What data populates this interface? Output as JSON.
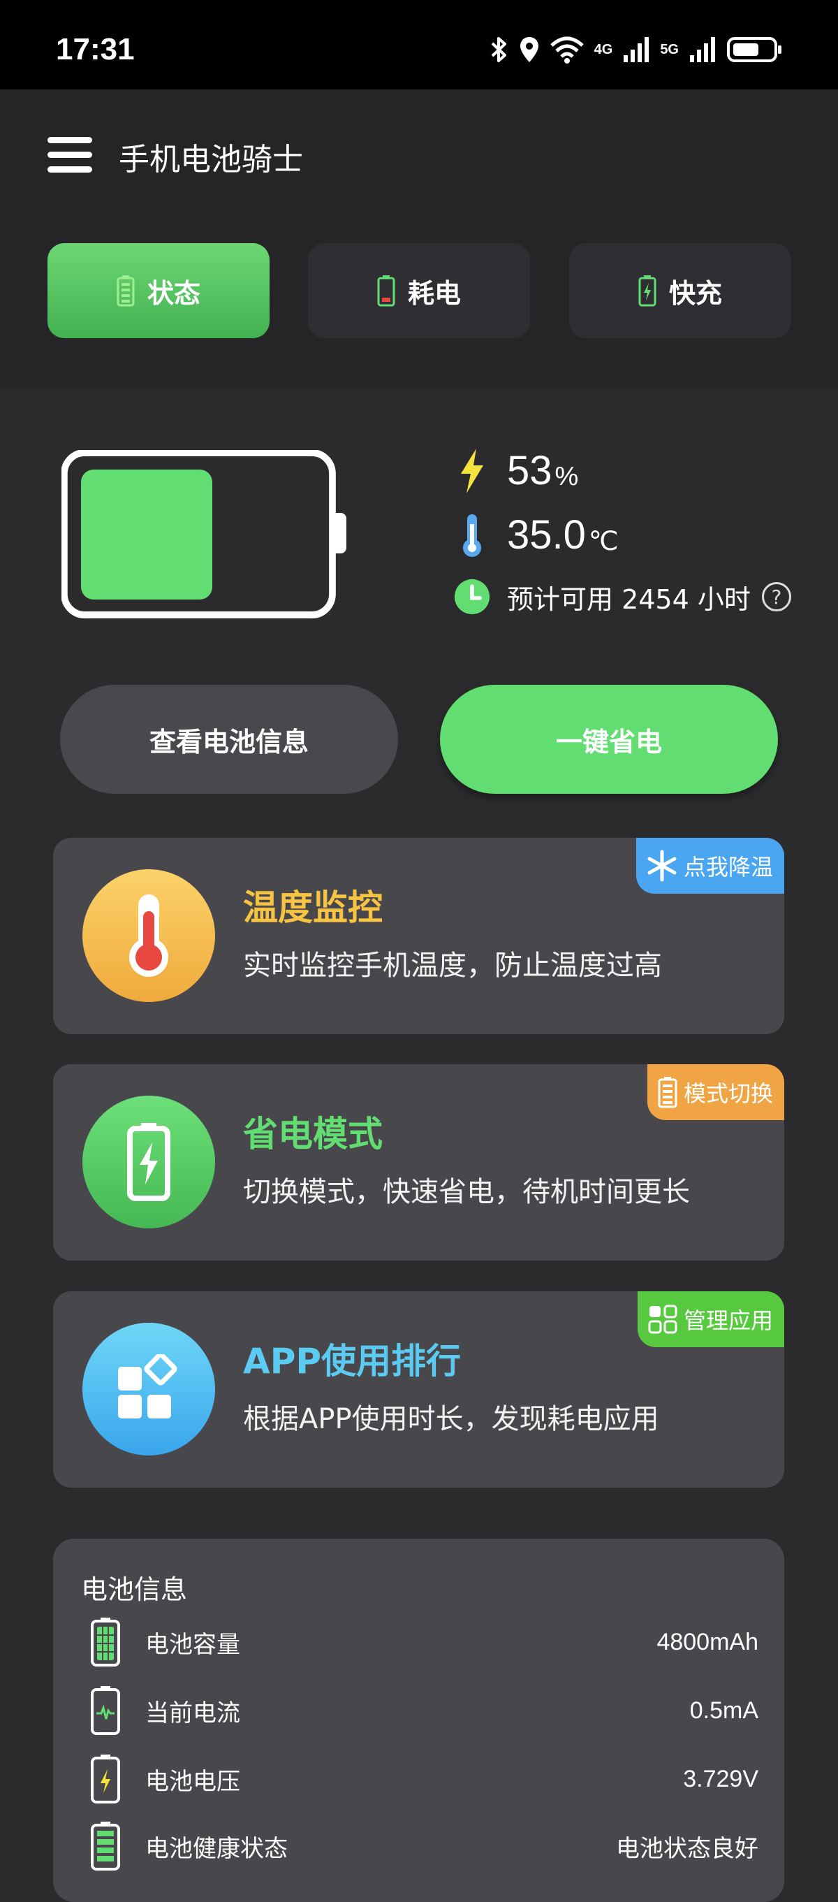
{
  "status_bar": {
    "time": "17:31",
    "icons": [
      "bluetooth-icon",
      "location-icon",
      "wifi-icon",
      "signal-4g-icon",
      "signal-5g-icon",
      "battery-icon"
    ],
    "net1": "4G",
    "net2": "5G"
  },
  "header": {
    "title": "手机电池骑士",
    "tabs": [
      {
        "label": "状态",
        "active": true
      },
      {
        "label": "耗电",
        "active": false
      },
      {
        "label": "快充",
        "active": false
      }
    ]
  },
  "battery": {
    "level": "53",
    "level_unit": "%",
    "level_fraction": 0.53,
    "temperature": "35.0",
    "temperature_unit": "℃",
    "estimate_text": "预计可用 2454 小时",
    "fill_color": "#62dd72"
  },
  "actions": {
    "info_button": "查看电池信息",
    "save_button": "一键省电"
  },
  "cards": [
    {
      "title": "温度监控",
      "desc": "实时监控手机温度，防止温度过高",
      "badge": "点我降温",
      "title_color": "#f6c343"
    },
    {
      "title": "省电模式",
      "desc": "切换模式，快速省电，待机时间更长",
      "badge": "模式切换",
      "title_color": "#62dd72"
    },
    {
      "title": "APP使用排行",
      "desc": "根据APP使用时长，发现耗电应用",
      "badge": "管理应用",
      "title_color": "#5ccbf2"
    }
  ],
  "battery_info": {
    "heading": "电池信息",
    "rows": [
      {
        "label": "电池容量",
        "value": "4800mAh",
        "icon": "battery-capacity-icon"
      },
      {
        "label": "当前电流",
        "value": "0.5mA",
        "icon": "battery-current-icon"
      },
      {
        "label": "电池电压",
        "value": "3.729V",
        "icon": "battery-voltage-icon"
      },
      {
        "label": "电池健康状态",
        "value": "电池状态良好",
        "icon": "battery-health-icon"
      }
    ]
  }
}
